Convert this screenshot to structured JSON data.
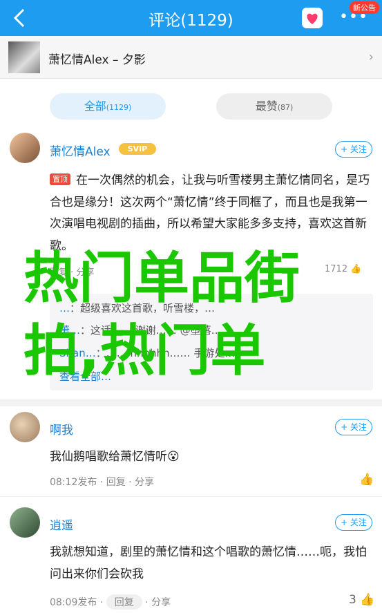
{
  "header": {
    "title": "评论(1129)",
    "notice_badge": "新公告",
    "more_label": "•••"
  },
  "song": {
    "title": "萧忆情Alex – 夕影"
  },
  "tabs": [
    {
      "label": "全部",
      "count": "(1129)"
    },
    {
      "label": "最赞",
      "count": "(87)"
    }
  ],
  "comments": [
    {
      "user": "萧忆情Alex",
      "badge": "SVIP",
      "pinned_label": "置顶",
      "text": "在一次偶然的机会，让我与听雪楼男主萧忆情同名，是巧合也是缘分！这次两个“萧忆情”终于同框了，而且也是我第一次演唱电视剧的插曲，所以希望大家能多多支持，喜欢这首新歌。",
      "meta": "回复 · 分享",
      "likes": "1712",
      "follow_label": "+ 关注",
      "replies": [
        {
          "user": "…",
          "text": "超级喜欢这首歌，听雪楼，…"
        },
        {
          "user": "萧…",
          "text": "这话…… 谢谢…… @堕落…"
        },
        {
          "user": "Shan…",
          "text": "…… hhhhhh…… 手游处…"
        }
      ],
      "view_all": "查看全部…"
    },
    {
      "user": "啊我",
      "text": "我仙鹅唱歌给萧忆情听😮",
      "time": "08:12发布",
      "reply": "回复",
      "share": "分享",
      "follow_label": "+ 关注"
    },
    {
      "user": "逍遥",
      "text": "我就想知道，剧里的萧忆情和这个唱歌的萧忆情……呃，我怕问出来你们会砍我",
      "time": "08:09发布",
      "reply": "回复",
      "share": "分享",
      "likes": "3",
      "follow_label": "+ 关注"
    }
  ],
  "overlay": {
    "line1": "热门单品街",
    "line2": "拍,热门单"
  },
  "colors": {
    "primary": "#1e9df0",
    "overlay_green": "#1ac700",
    "pin_red": "#e94c3d",
    "svip_gold": "#f5c240"
  }
}
